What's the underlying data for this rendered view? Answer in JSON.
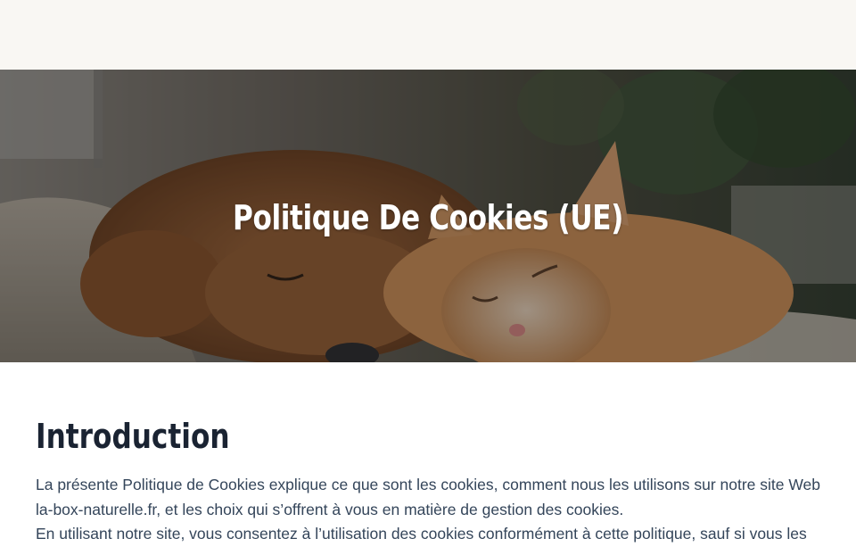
{
  "hero": {
    "title": "Politique De Cookies (UE)",
    "image_icon": "dog-and-kitten-photo"
  },
  "intro": {
    "heading": "Introduction",
    "lines": [
      "La présente Politique de Cookies explique ce que sont les cookies, comment nous les utilisons sur notre site Web",
      "la-box-naturelle.fr, et les choix qui s’offrent à vous en matière de gestion des cookies.",
      "En utilisant notre site, vous consentez à l’utilisation des cookies conformément à cette politique, sauf si vous les"
    ]
  },
  "colors": {
    "header_bg": "#f9f7f3",
    "heading": "#1a2332",
    "body_text": "#34455a",
    "hero_title": "#ffffff"
  }
}
